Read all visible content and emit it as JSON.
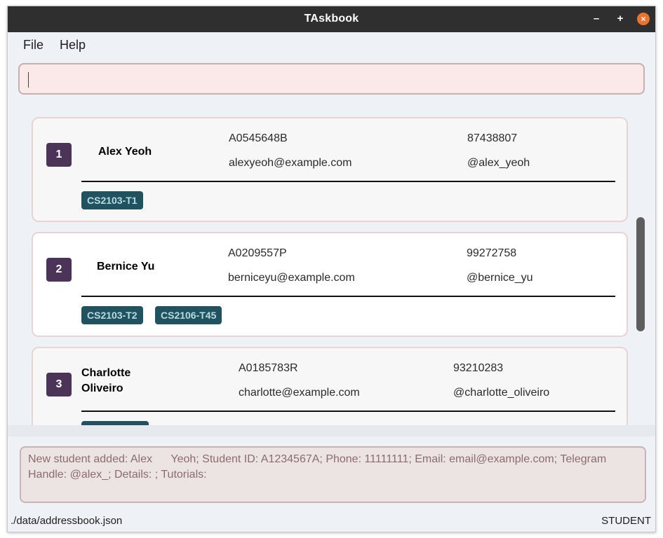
{
  "window": {
    "title": "TAskbook",
    "controls": {
      "minimize": "–",
      "maximize": "+",
      "close": "×"
    }
  },
  "menu": {
    "file": "File",
    "help": "Help"
  },
  "command": {
    "value": ""
  },
  "students": [
    {
      "index": "1",
      "name": "Alex Yeoh",
      "student_id": "A0545648B",
      "phone": "87438807",
      "email": "alexyeoh@example.com",
      "telegram": "@alex_yeoh",
      "tags": [
        "CS2103-T1"
      ]
    },
    {
      "index": "2",
      "name": "Bernice Yu",
      "student_id": "A0209557P",
      "phone": "99272758",
      "email": "berniceyu@example.com",
      "telegram": "@bernice_yu",
      "tags": [
        "CS2103-T2",
        "CS2106-T45"
      ]
    },
    {
      "index": "3",
      "name_line1": "Charlotte",
      "name_line2": "Oliveiro",
      "student_id": "A0185783R",
      "phone": "93210283",
      "email": "charlotte@example.com",
      "telegram": "@charlotte_oliveiro",
      "tags": [
        ""
      ]
    }
  ],
  "result": {
    "message": "New student added: Alex      Yeoh; Student ID: A1234567A; Phone: 11111111; Email: email@example.com; Telegram Handle: @alex_; Details: ; Tutorials:"
  },
  "status": {
    "file_path": "./data/addressbook.json",
    "mode": "STUDENT"
  },
  "colors": {
    "title_bar": "#2f2f2f",
    "close_button": "#e9732f",
    "index_badge": "#4c3459",
    "tag_background": "#21525f",
    "command_box": "#fbe8e8",
    "result_text": "#8c6c6c"
  }
}
